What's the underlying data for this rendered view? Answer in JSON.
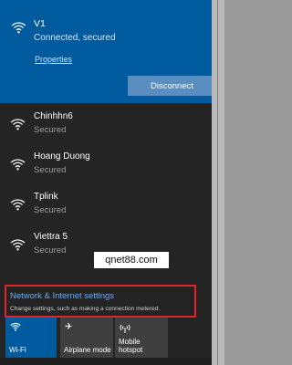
{
  "connected": {
    "name": "V1",
    "status": "Connected, secured",
    "properties_label": "Properties",
    "disconnect_label": "Disconnect"
  },
  "networks": [
    {
      "name": "Chinhhn6",
      "status": "Secured"
    },
    {
      "name": "Hoang Duong",
      "status": "Secured"
    },
    {
      "name": "Tplink",
      "status": "Secured"
    },
    {
      "name": "Viettra 5",
      "status": "Secured"
    }
  ],
  "watermark": "qnet88.com",
  "settings": {
    "title": "Network & Internet settings",
    "description": "Change settings, such as making a connection metered."
  },
  "tiles": {
    "wifi": "Wi-Fi",
    "airplane": "Airplane mode",
    "hotspot_line1": "Mobile",
    "hotspot_line2": "hotspot"
  },
  "colors": {
    "accent": "#005a9e",
    "highlight_border": "#e0242b"
  },
  "icons": {
    "wifi": "wifi-icon",
    "airplane": "airplane-icon",
    "hotspot": "hotspot-icon"
  }
}
